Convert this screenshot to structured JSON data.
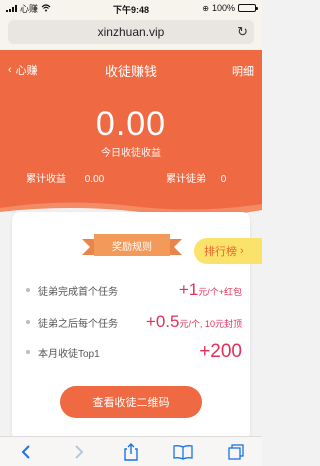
{
  "status": {
    "carrier": "心赚",
    "time": "下午9:48",
    "battery": "100%"
  },
  "browser": {
    "url": "xinzhuan.vip"
  },
  "nav": {
    "back_label": "心赚",
    "title": "收徒赚钱",
    "detail_label": "明细"
  },
  "summary": {
    "amount": "0.00",
    "amount_label": "今日收徒收益",
    "total_income_label": "累计收益",
    "total_income_value": "0.00",
    "total_apprentices_label": "累计徒弟",
    "total_apprentices_value": "0"
  },
  "card": {
    "ribbon_label": "奖励规则",
    "ranking_label": "排行榜",
    "rules": [
      {
        "text": "徒弟完成首个任务",
        "value_big": "+1",
        "value_small": "元/个+红包"
      },
      {
        "text": "徒弟之后每个任务",
        "value_big": "+0.5",
        "value_small": "元/个, 10元封顶"
      },
      {
        "text": "本月收徒Top1",
        "value_big": "+200",
        "value_small": ""
      }
    ],
    "qr_button_label": "查看收徒二维码"
  },
  "colors": {
    "primary": "#ef6a43",
    "accent": "#e0315a",
    "ribbon": "#f39a5b",
    "ranking_bg": "#fbe36b"
  },
  "toolbar": {
    "icons": [
      "back-icon",
      "forward-icon",
      "share-icon",
      "bookmarks-icon",
      "tabs-icon"
    ]
  }
}
